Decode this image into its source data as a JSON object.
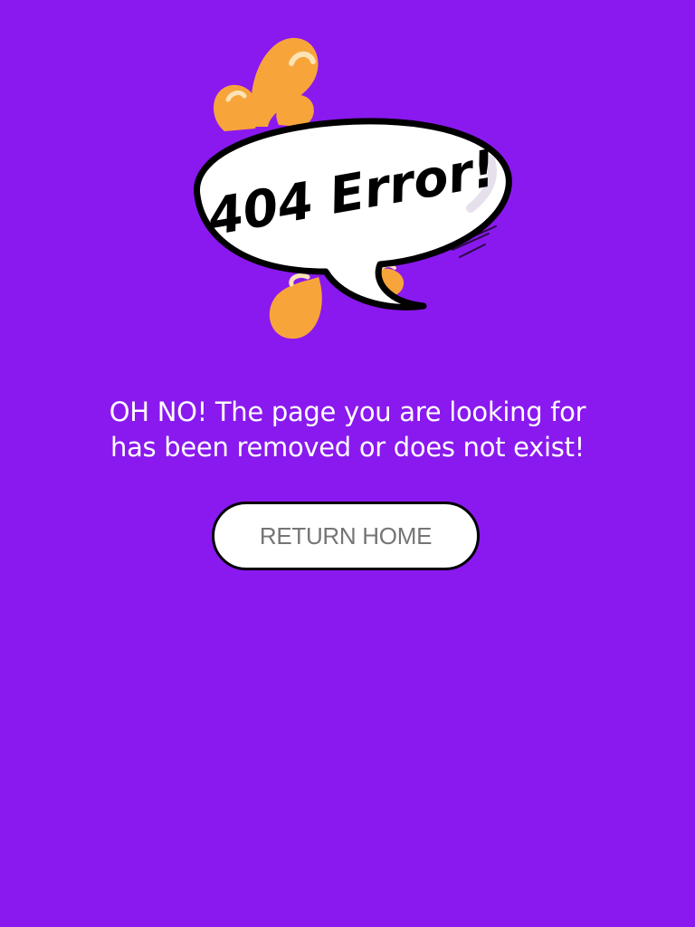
{
  "colors": {
    "background": "#8a19ef",
    "splash": "#f7a53a",
    "splash_highlight": "#fde3b5",
    "bubble_fill": "#ffffff",
    "bubble_outline": "#000000",
    "button_text": "#757575"
  },
  "illustration": {
    "bubble_text": "404 Error!",
    "icon": "speech-bubble-with-splashes"
  },
  "message": {
    "line1": "OH NO! The page you are looking for",
    "line2": "has been removed or does not exist!"
  },
  "button": {
    "label": "RETURN HOME"
  }
}
